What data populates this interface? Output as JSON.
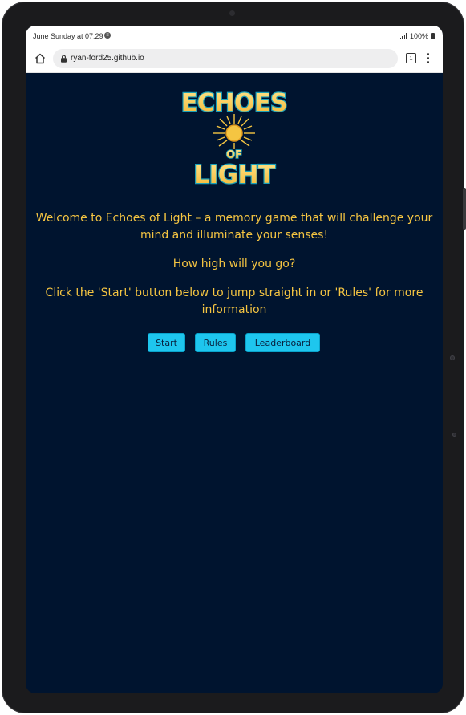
{
  "status_bar": {
    "time": "June Sunday at 07:29",
    "battery": "100%",
    "message_icon": "notification-icon",
    "signal_icon": "signal-icon",
    "battery_icon": "battery-icon"
  },
  "browser": {
    "url": "ryan-ford25.github.io",
    "tab_count": "1",
    "home_icon": "home-icon",
    "lock_icon": "lock-icon",
    "menu_icon": "more-vertical-icon"
  },
  "game": {
    "logo": {
      "line1": "ECHOES",
      "line2": "OF",
      "line3": "LIGHT"
    },
    "intro": {
      "welcome": "Welcome to Echoes of Light – a memory game that will challenge your mind and illuminate your senses!",
      "question": "How high will you go?",
      "instructions": "Click the 'Start' button below to jump straight in or 'Rules' for more information"
    },
    "buttons": {
      "start": "Start",
      "rules": "Rules",
      "leaderboard": "Leaderboard"
    }
  },
  "colors": {
    "background": "#00142f",
    "text": "#f5c542",
    "button": "#1ec6ee",
    "button_text": "#08203d"
  }
}
